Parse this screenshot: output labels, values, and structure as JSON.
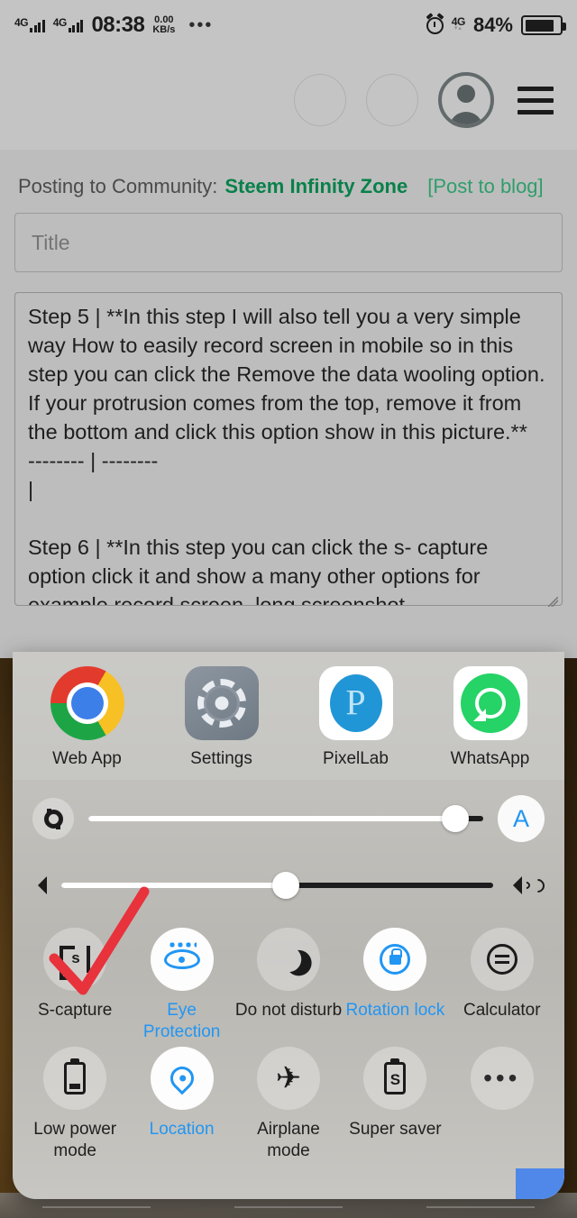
{
  "status_bar": {
    "network_left": "4G",
    "network_left_2": "4G",
    "time": "08:38",
    "data_speed_value": "0.00",
    "data_speed_unit": "KB/s",
    "overflow": "•••",
    "alarm_icon": "alarm-clock-icon",
    "network_right": "4G",
    "battery_percent": "84%"
  },
  "browser": {
    "ghost_button_1": "",
    "ghost_button_2": "",
    "avatar_icon": "user-avatar-icon",
    "menu_icon": "hamburger-menu-icon"
  },
  "post_editor": {
    "posting_prefix": "Posting to Community:",
    "community": "Steem Infinity Zone",
    "post_to_blog": "[Post to blog]",
    "title_placeholder": "Title",
    "title_value": "",
    "body": "Step 5 | **In this step I will also tell you a very simple way How to easily record screen in mobile so in this step you can click the Remove the data wooling option. If your protrusion comes from the top, remove it from the bottom and click this option show in this picture.**\n-------- | --------\n|\n\nStep 6 | **In this step you can click the s- capture option click it and show a many other options for example record screen, long screenshot,"
  },
  "control_center": {
    "apps": [
      {
        "label": "Web App",
        "icon": "chrome-icon"
      },
      {
        "label": "Settings",
        "icon": "settings-gear-icon"
      },
      {
        "label": "PixelLab",
        "icon": "pixellab-icon"
      },
      {
        "label": "WhatsApp",
        "icon": "whatsapp-icon"
      }
    ],
    "brightness": {
      "icon": "brightness-gear-icon",
      "value_percent": 93,
      "auto_label": "A"
    },
    "volume": {
      "icon_low": "volume-mute-icon",
      "icon_high": "volume-up-icon",
      "value_percent": 52
    },
    "toggles": [
      {
        "label": "S-capture",
        "icon": "s-capture-icon",
        "active": false
      },
      {
        "label": "Eye Protection",
        "icon": "eye-icon",
        "active": true
      },
      {
        "label": "Do not disturb",
        "icon": "moon-icon",
        "active": false
      },
      {
        "label": "Rotation lock",
        "icon": "rotation-lock-icon",
        "active": true
      },
      {
        "label": "Calculator",
        "icon": "calculator-icon",
        "active": false
      },
      {
        "label": "Low power mode",
        "icon": "battery-icon",
        "active": false
      },
      {
        "label": "Location",
        "icon": "location-pin-icon",
        "active": true
      },
      {
        "label": "Airplane mode",
        "icon": "airplane-icon",
        "active": false
      },
      {
        "label": "Super saver",
        "icon": "battery-s-icon",
        "active": false
      },
      {
        "label": "",
        "icon": "more-dots-icon",
        "active": false
      }
    ]
  },
  "annotation": {
    "color": "#e8323c",
    "shape": "red-arrow-pointing-to-s-capture"
  }
}
